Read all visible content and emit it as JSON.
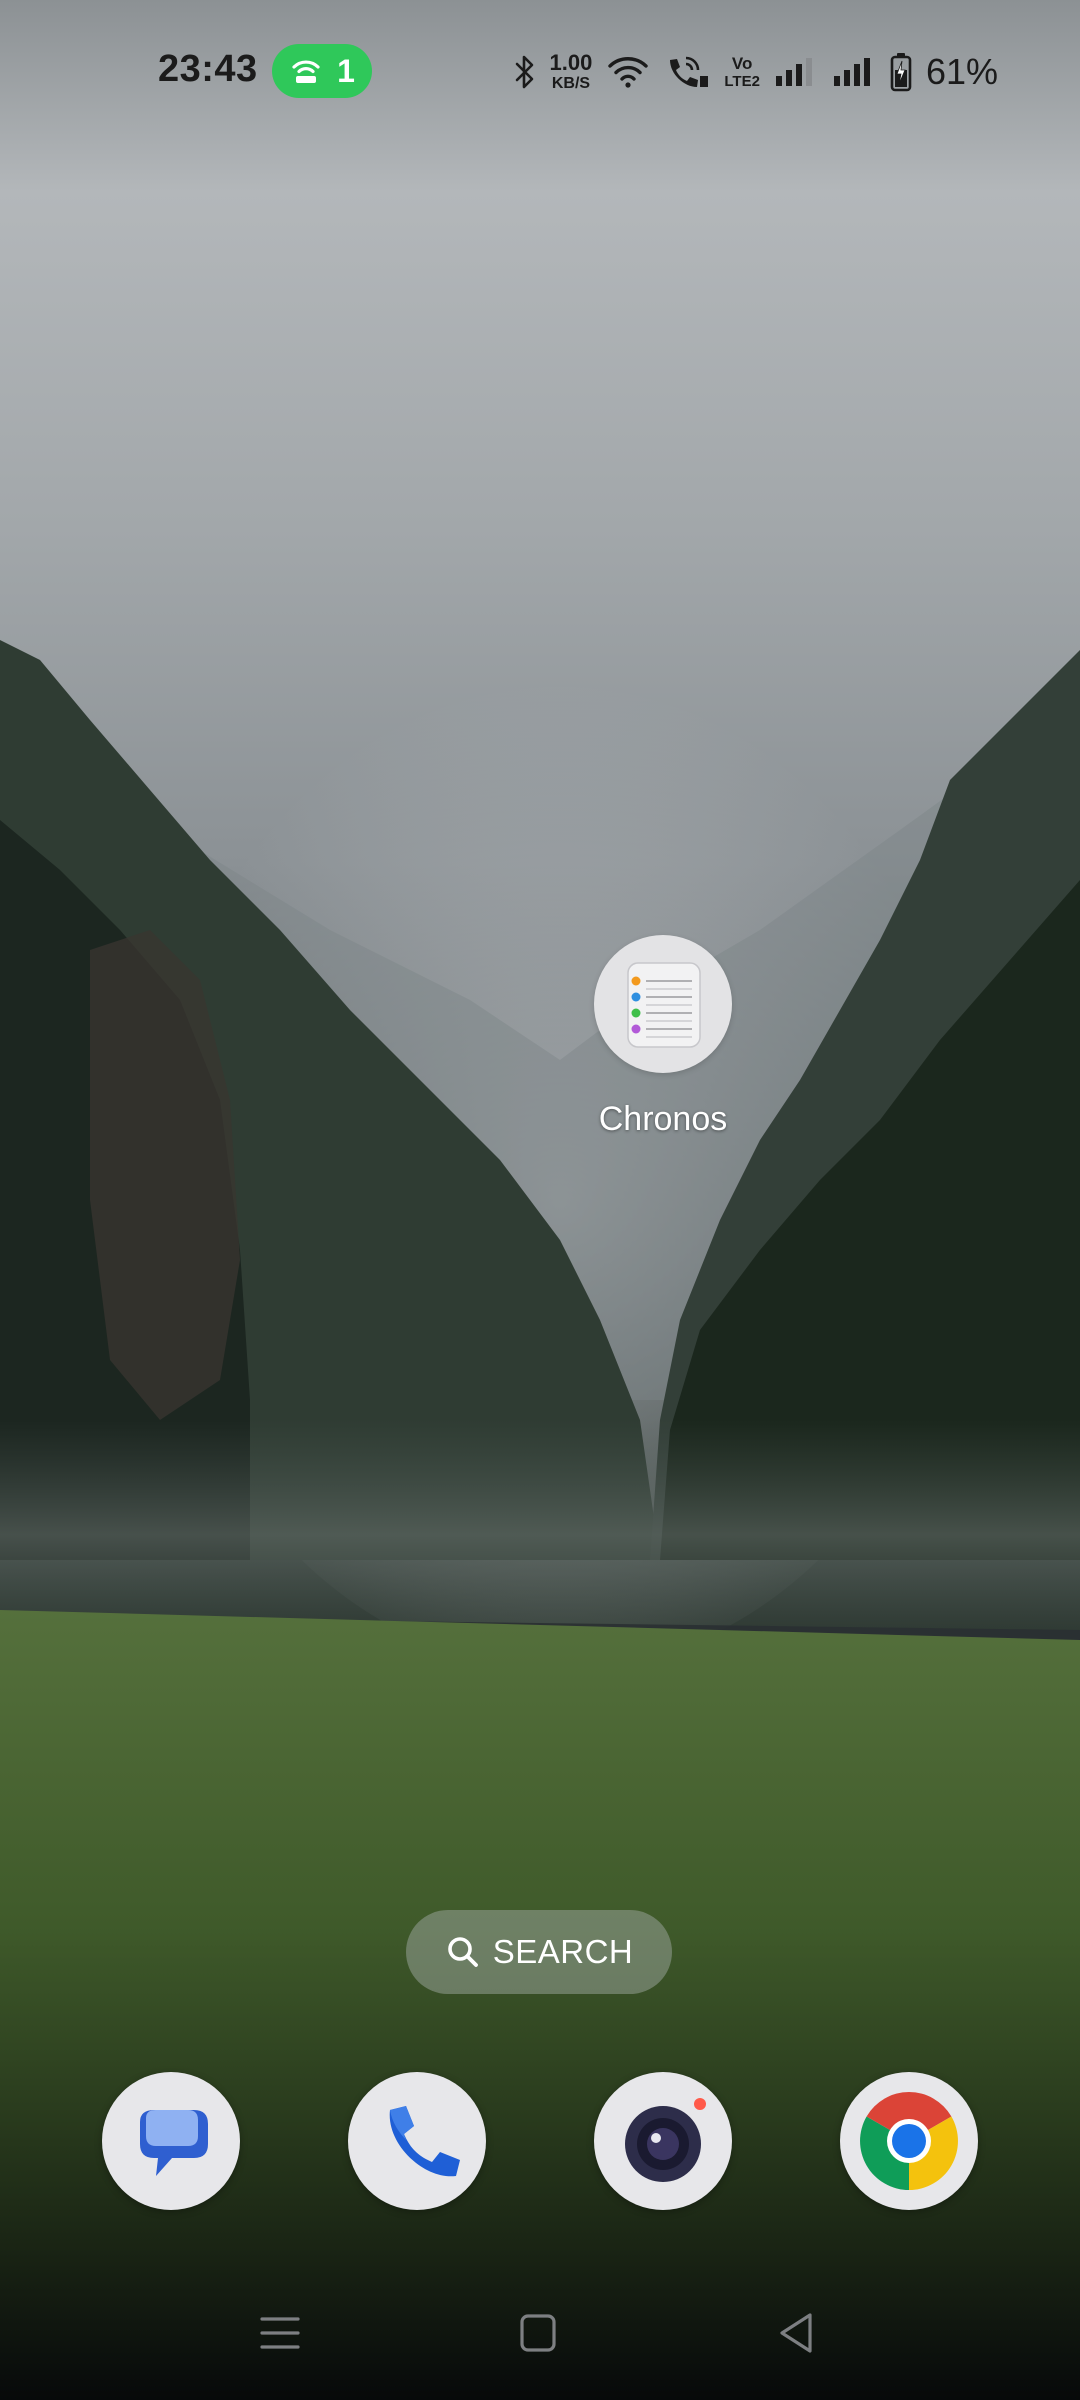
{
  "status_bar": {
    "time": "23:43",
    "hotspot_count": "1",
    "net_speed_value": "1.00",
    "net_speed_unit": "KB/S",
    "volte_top": "Vo",
    "volte_bottom": "LTE2",
    "battery_percent": "61%",
    "icons": [
      "hotspot-icon",
      "bluetooth-icon",
      "wifi-icon",
      "wifi-calling-icon",
      "signal-1-icon",
      "signal-2-icon",
      "battery-charging-icon"
    ],
    "hotspot_color": "#2fc85a"
  },
  "home": {
    "apps": [
      {
        "label": "Chronos",
        "icon": "reminders-list-icon"
      }
    ],
    "search": {
      "label": "SEARCH",
      "icon": "search-icon"
    }
  },
  "dock": {
    "apps": [
      {
        "name": "Messages",
        "icon": "messages-icon"
      },
      {
        "name": "Phone",
        "icon": "phone-icon"
      },
      {
        "name": "Camera",
        "icon": "camera-icon"
      },
      {
        "name": "Chrome",
        "icon": "chrome-icon"
      }
    ]
  },
  "navigation": {
    "buttons": [
      "menu-icon",
      "home-square-icon",
      "back-triangle-icon"
    ]
  }
}
